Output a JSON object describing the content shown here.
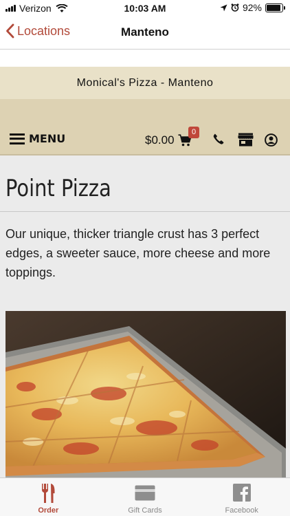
{
  "status_bar": {
    "carrier": "Verizon",
    "time": "10:03 AM",
    "battery": "92%",
    "battery_level": 0.92
  },
  "nav": {
    "back_label": "Locations",
    "title": "Manteno"
  },
  "store": {
    "name": "Monical's Pizza - Manteno"
  },
  "toolbar": {
    "menu_label": "MENU",
    "cart_total": "$0.00",
    "cart_count": "0",
    "accent_color": "#c0473a"
  },
  "product": {
    "title": "Point Pizza",
    "description": "Our unique, thicker triangle crust has 3 perfect edges, a sweeter sauce, more cheese and more toppings."
  },
  "tabs": [
    {
      "label": "Order",
      "icon": "fork-knife-icon",
      "active": true
    },
    {
      "label": "Gift Cards",
      "icon": "gift-card-icon",
      "active": false
    },
    {
      "label": "Facebook",
      "icon": "facebook-icon",
      "active": false
    }
  ]
}
